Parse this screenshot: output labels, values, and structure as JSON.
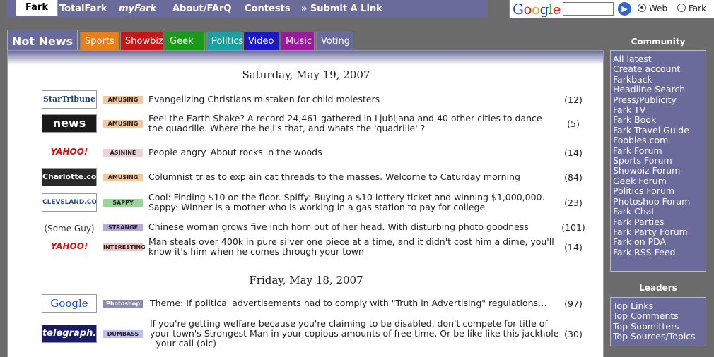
{
  "topnav": {
    "active": "Fark",
    "items": [
      "TotalFark",
      "myFark",
      "About/FArQ",
      "Contests",
      "» Submit A Link"
    ]
  },
  "google": {
    "logo": "Google",
    "button_icon": "arrow-right-icon",
    "radio_web": "Web",
    "radio_fark": "Fark",
    "selected": "Web"
  },
  "tabs": {
    "active": "Not News",
    "items": [
      {
        "label": "Sports",
        "color": "#e8801a"
      },
      {
        "label": "Showbiz",
        "color": "#c41818"
      },
      {
        "label": "Geek",
        "color": "#1a9a1a"
      },
      {
        "label": "Politics",
        "color": "#1aa0a0"
      },
      {
        "label": "Video",
        "color": "#1a1ac4"
      },
      {
        "label": "Music",
        "color": "#9a1a9a"
      },
      {
        "label": "Voting",
        "color": "#6b6b9b"
      }
    ]
  },
  "days": [
    {
      "date": "Saturday, May 19, 2007",
      "items": [
        {
          "source": "StarTribune",
          "tag": "AMUSING",
          "headline": "Evangelizing Christians mistaken for child molesters",
          "count": "(12)"
        },
        {
          "source": "news",
          "tag": "AMUSING",
          "headline": "Feel the Earth Shake? A record 24,461 gathered in Ljubljana and 40 other cities to dance the quadrille. Where the hell's that, and whats the 'quadrille' ?",
          "count": "(5)"
        },
        {
          "source": "YAHOO! NEWS",
          "tag": "ASININE",
          "headline": "People angry. About rocks in the woods",
          "count": "(14)"
        },
        {
          "source": "Charlotte.com",
          "tag": "AMUSING",
          "headline": "Columnist tries to explain cat threads to the masses. Welcome to Caturday morning",
          "count": "(84)"
        },
        {
          "source": "CLEVELAND.COM",
          "tag": "SAPPY",
          "headline": "Cool: Finding $10 on the floor. Spiffy: Buying a $10 lottery ticket and winning $1,000,000. Sappy: Winner is a mother who is working in a gas station to pay for college",
          "count": "(23)"
        },
        {
          "source": "(Some Guy)",
          "tag": "STRANGE",
          "headline": "Chinese woman grows five inch horn out of her head. With disturbing photo goodness",
          "count": "(101)"
        },
        {
          "source": "YAHOO! NEWS",
          "tag": "INTERESTING",
          "headline": "Man steals over 400k in pure silver one piece at a time, and it didn't cost him a dime, you'll know it's him when he comes through your town",
          "count": "(14)"
        }
      ]
    },
    {
      "date": "Friday, May 18, 2007",
      "items": [
        {
          "source": "Google",
          "tag": "Photoshop",
          "headline": "Theme: If political advertisements had to comply with \"Truth in Advertising\" regulations…",
          "count": "(97)"
        },
        {
          "source": "telegraph.co.uk",
          "tag": "DUMBASS",
          "headline": "If you're getting welfare because you're claiming to be disabled, don't compete for title of your town's Strongest Man in your copious amounts of free time. Or be like like this jackhole - your call (pic)",
          "count": "(30)"
        }
      ]
    }
  ],
  "sidebar": {
    "community_title": "Community",
    "community": [
      "All latest",
      "Create account",
      "Farkback",
      "Headline Search",
      "Press/Publicity",
      "Fark TV",
      "Fark Book",
      "Fark Travel Guide",
      "Foobies.com",
      "Fark Forum",
      "Sports Forum",
      "Showbiz Forum",
      "Geek Forum",
      "Politics Forum",
      "Photoshop Forum",
      "Fark Chat",
      "Fark Parties",
      "Fark Party Forum",
      "Fark on PDA",
      "Fark RSS Feed"
    ],
    "leaders_title": "Leaders",
    "leaders": [
      "Top Links",
      "Top Comments",
      "Top Submitters",
      "Top Sources/Topics"
    ]
  }
}
